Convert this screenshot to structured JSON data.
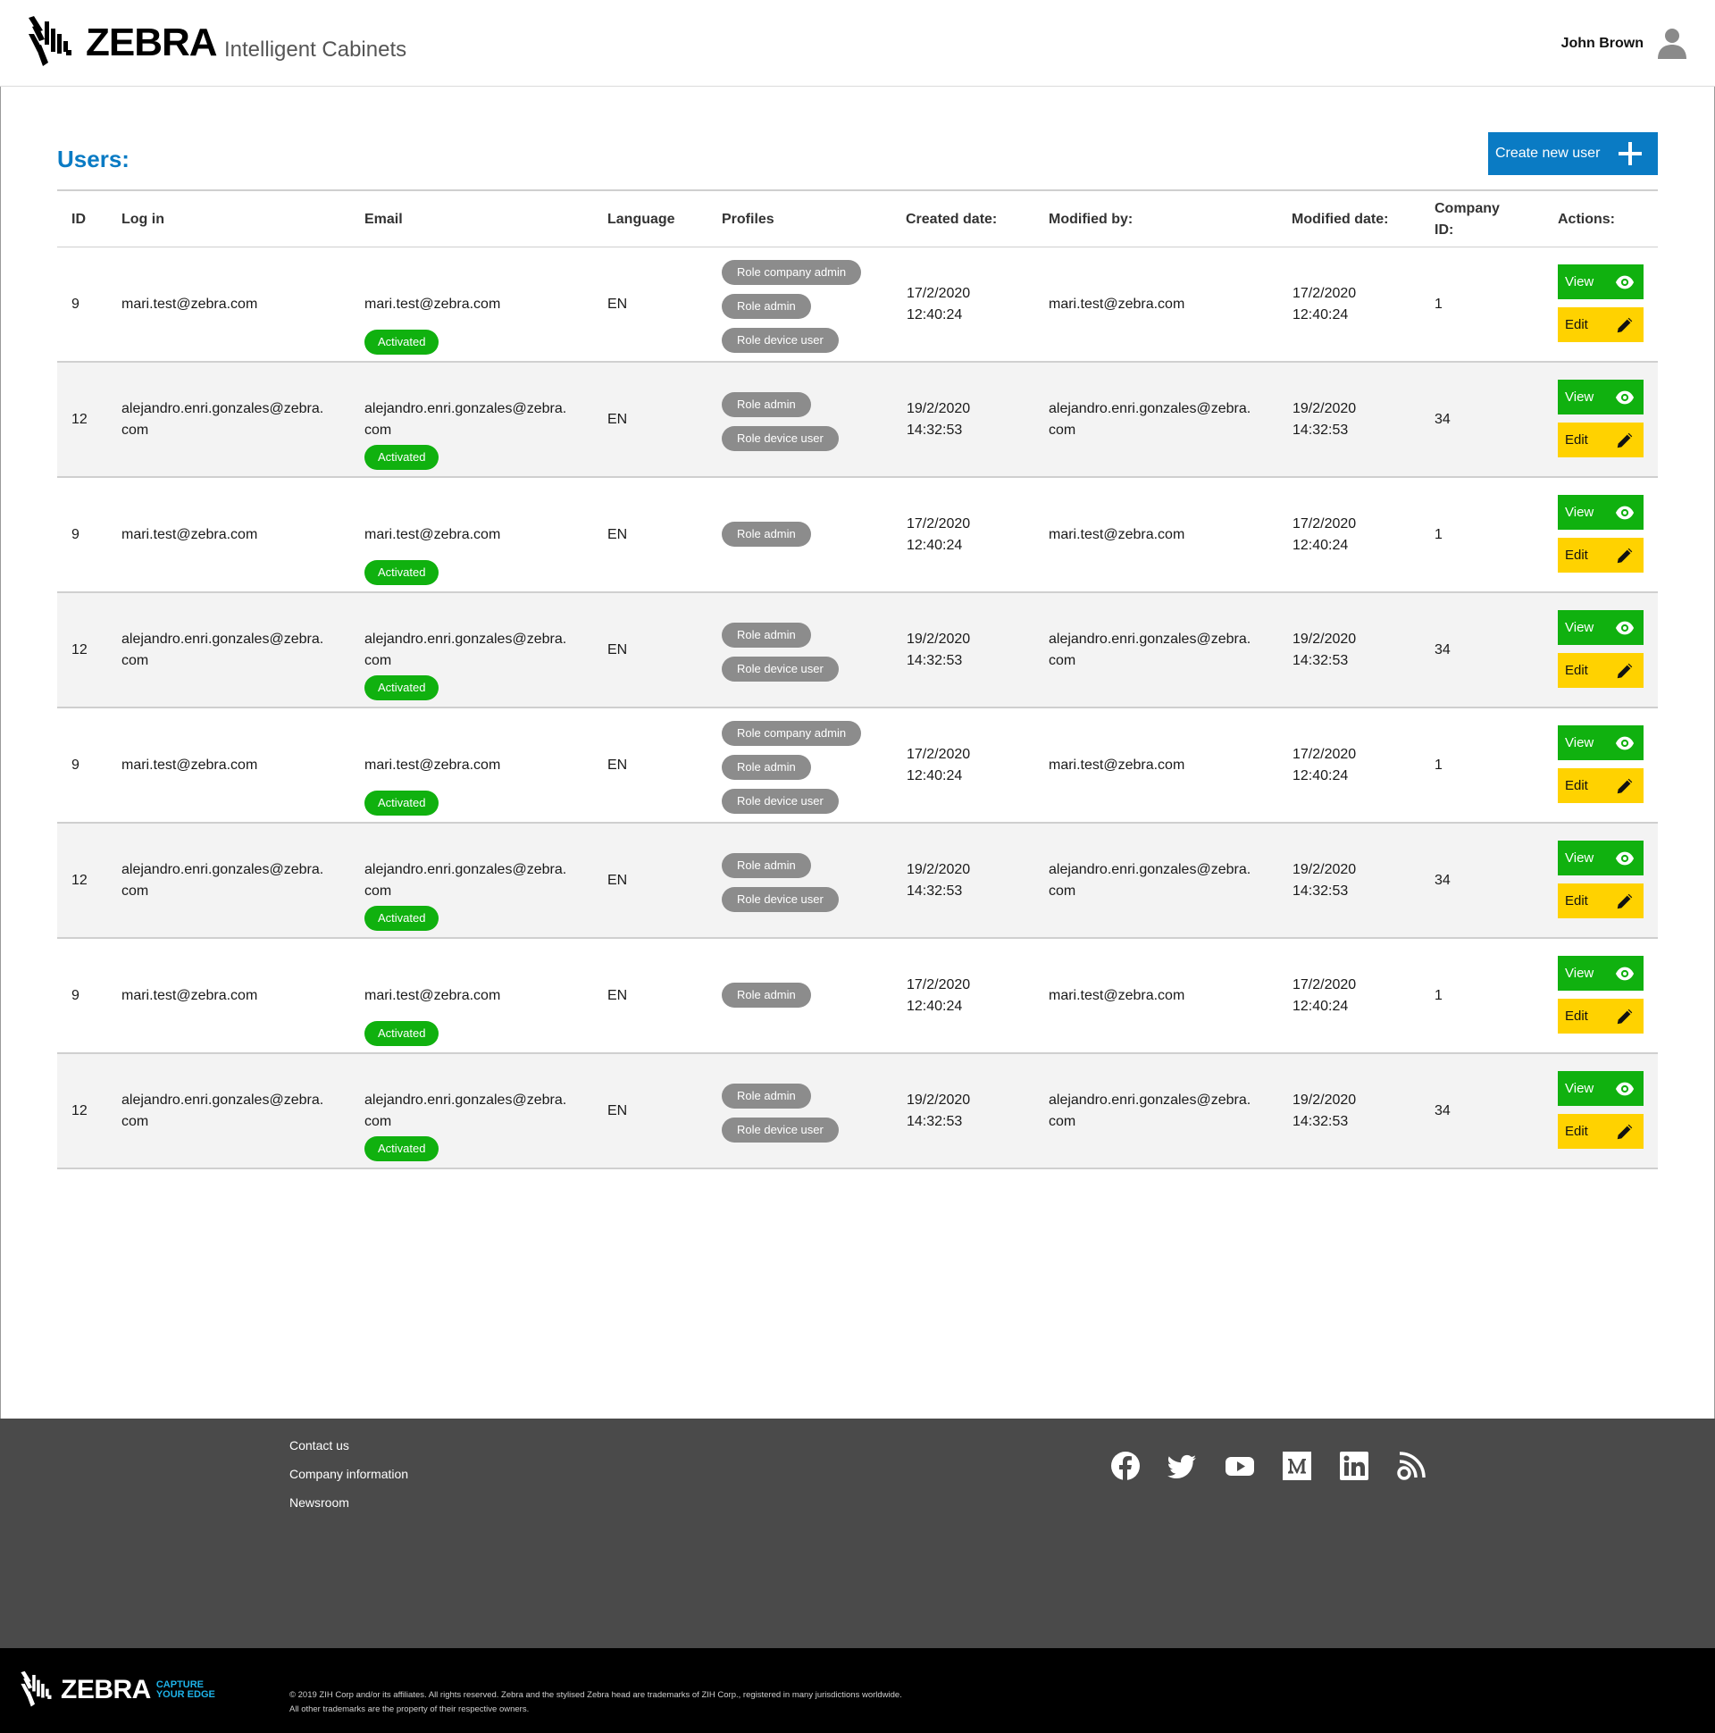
{
  "header": {
    "brand": "ZEBRA",
    "app_title": "Intelligent Cabinets",
    "user_name": "John Brown"
  },
  "main": {
    "page_title": "Users:",
    "create_button_label": "Create new user",
    "columns": {
      "id": "ID",
      "login": "Log in",
      "email": "Email",
      "language": "Language",
      "profiles": "Profiles",
      "created": "Created date:",
      "modified_by": "Modified by:",
      "modified_date": "Modified date:",
      "company_id": "Company ID:",
      "actions": "Actions:"
    },
    "status_label": "Activated",
    "view_label": "View",
    "edit_label": "Edit",
    "rows": [
      {
        "id": "9",
        "login": "mari.test@zebra.com",
        "email": "mari.test@zebra.com",
        "language": "EN",
        "roles": [
          "Role company admin",
          "Role admin",
          "Role device user"
        ],
        "created_date": "17/2/2020",
        "created_time": "12:40:24",
        "modified_by": "mari.test@zebra.com",
        "modified_date": "17/2/2020",
        "modified_time": "12:40:24",
        "company_id": "1"
      },
      {
        "id": "12",
        "login": "alejandro.enri.gonzales@zebra.com",
        "email": "alejandro.enri.gonzales@zebra.com",
        "language": "EN",
        "roles": [
          "Role admin",
          "Role device user"
        ],
        "created_date": "19/2/2020",
        "created_time": "14:32:53",
        "modified_by": "alejandro.enri.gonzales@zebra.com",
        "modified_date": "19/2/2020",
        "modified_time": "14:32:53",
        "company_id": "34"
      },
      {
        "id": "9",
        "login": "mari.test@zebra.com",
        "email": "mari.test@zebra.com",
        "language": "EN",
        "roles": [
          "Role admin"
        ],
        "created_date": "17/2/2020",
        "created_time": "12:40:24",
        "modified_by": "mari.test@zebra.com",
        "modified_date": "17/2/2020",
        "modified_time": "12:40:24",
        "company_id": "1"
      },
      {
        "id": "12",
        "login": "alejandro.enri.gonzales@zebra.com",
        "email": "alejandro.enri.gonzales@zebra.com",
        "language": "EN",
        "roles": [
          "Role admin",
          "Role device user"
        ],
        "created_date": "19/2/2020",
        "created_time": "14:32:53",
        "modified_by": "alejandro.enri.gonzales@zebra.com",
        "modified_date": "19/2/2020",
        "modified_time": "14:32:53",
        "company_id": "34"
      },
      {
        "id": "9",
        "login": "mari.test@zebra.com",
        "email": "mari.test@zebra.com",
        "language": "EN",
        "roles": [
          "Role company admin",
          "Role admin",
          "Role device user"
        ],
        "created_date": "17/2/2020",
        "created_time": "12:40:24",
        "modified_by": "mari.test@zebra.com",
        "modified_date": "17/2/2020",
        "modified_time": "12:40:24",
        "company_id": "1"
      },
      {
        "id": "12",
        "login": "alejandro.enri.gonzales@zebra.com",
        "email": "alejandro.enri.gonzales@zebra.com",
        "language": "EN",
        "roles": [
          "Role admin",
          "Role device user"
        ],
        "created_date": "19/2/2020",
        "created_time": "14:32:53",
        "modified_by": "alejandro.enri.gonzales@zebra.com",
        "modified_date": "19/2/2020",
        "modified_time": "14:32:53",
        "company_id": "34"
      },
      {
        "id": "9",
        "login": "mari.test@zebra.com",
        "email": "mari.test@zebra.com",
        "language": "EN",
        "roles": [
          "Role admin"
        ],
        "created_date": "17/2/2020",
        "created_time": "12:40:24",
        "modified_by": "mari.test@zebra.com",
        "modified_date": "17/2/2020",
        "modified_time": "12:40:24",
        "company_id": "1"
      },
      {
        "id": "12",
        "login": "alejandro.enri.gonzales@zebra.com",
        "email": "alejandro.enri.gonzales@zebra.com",
        "language": "EN",
        "roles": [
          "Role admin",
          "Role device user"
        ],
        "created_date": "19/2/2020",
        "created_time": "14:32:53",
        "modified_by": "alejandro.enri.gonzales@zebra.com",
        "modified_date": "19/2/2020",
        "modified_time": "14:32:53",
        "company_id": "34"
      }
    ]
  },
  "footer": {
    "links": [
      "Contact us",
      "Company information",
      "Newsroom"
    ],
    "social_icons": [
      "facebook-icon",
      "twitter-icon",
      "youtube-icon",
      "medium-icon",
      "linkedin-icon",
      "blog-icon"
    ],
    "brand": "ZEBRA",
    "tagline_1": "CAPTURE",
    "tagline_2": "YOUR EDGE",
    "legal_1": "© 2019 ZIH Corp and/or its affiliates. All rights reserved. Zebra and the stylised Zebra head are trademarks of ZIH Corp., registered in many jurisdictions worldwide.",
    "legal_2": "All other trademarks are the property of their respective owners."
  },
  "colors": {
    "accent_blue": "#0a7bc4",
    "view_green": "#10b10f",
    "edit_yellow": "#ffd200",
    "role_gray": "#8c8c8c",
    "footer_gray": "#4a4a4a"
  }
}
